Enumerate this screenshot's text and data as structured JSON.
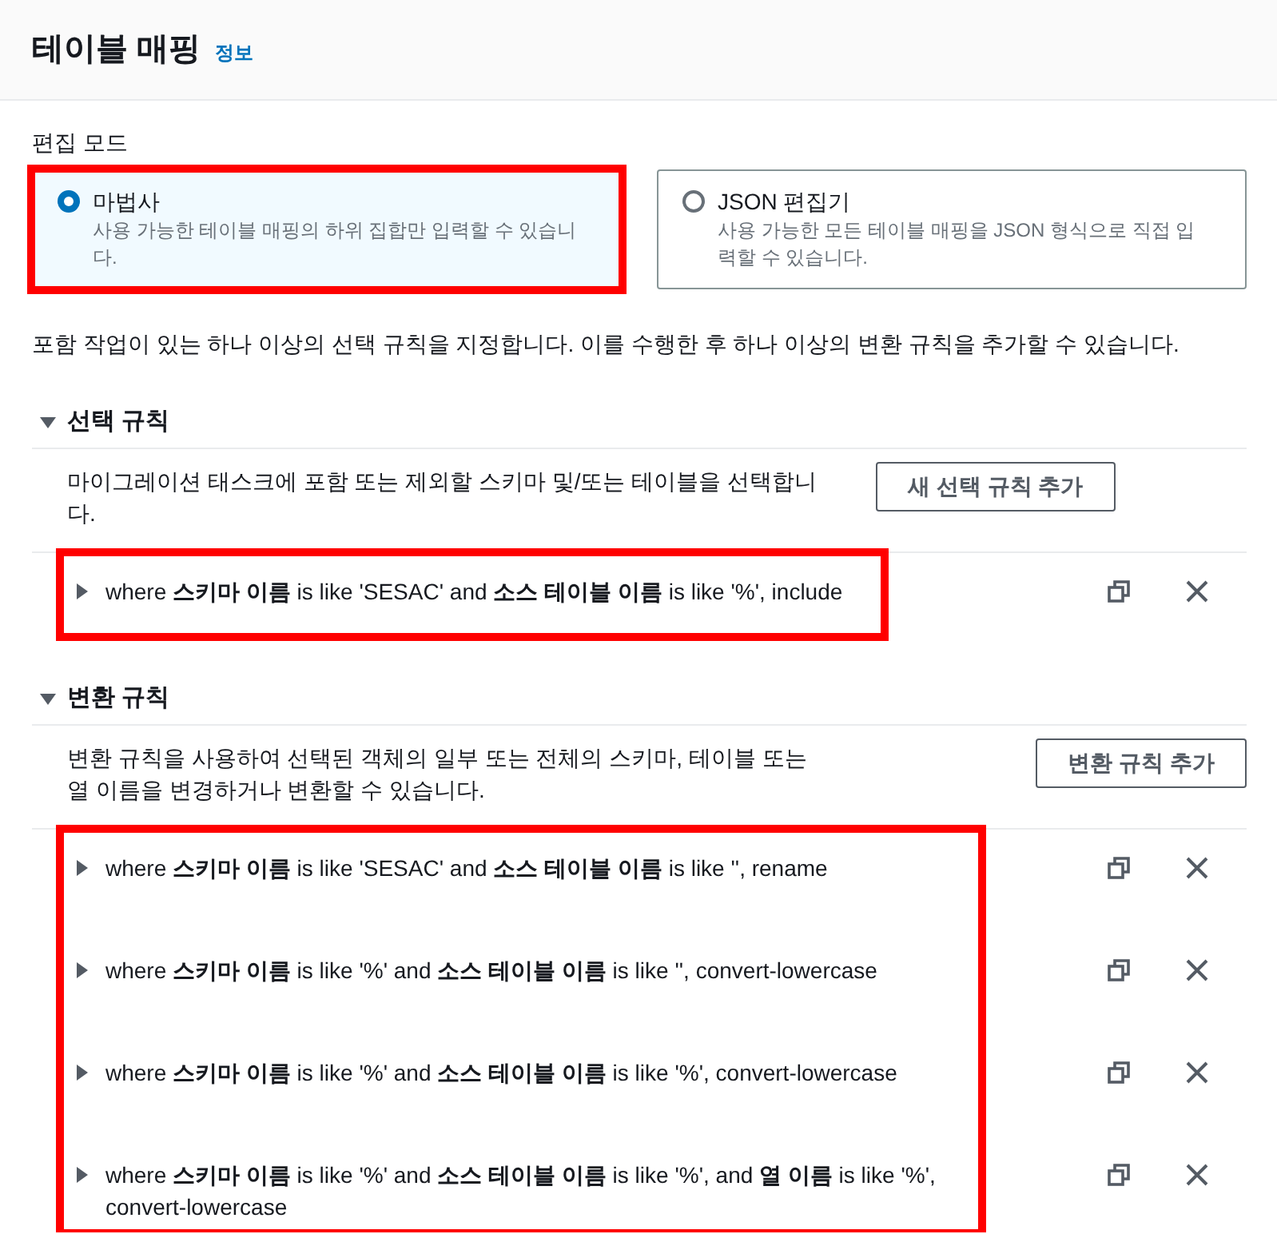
{
  "header": {
    "title": "테이블 매핑",
    "info_link": "정보"
  },
  "edit_mode": {
    "label": "편집 모드",
    "options": [
      {
        "title": "마법사",
        "description": "사용 가능한 테이블 매핑의 하위 집합만 입력할 수 있습니다.",
        "selected": true,
        "highlighted": true
      },
      {
        "title": "JSON 편집기",
        "description": "사용 가능한 모든 테이블 매핑을 JSON 형식으로 직접 입력할 수 있습니다.",
        "selected": false,
        "highlighted": false
      }
    ]
  },
  "intro": "포함 작업이 있는 하나 이상의 선택 규칙을 지정합니다. 이를 수행한 후 하나 이상의 변환 규칙을 추가할 수 있습니다.",
  "sections": [
    {
      "kind": "selection",
      "title": "선택 규칙",
      "expanded": true,
      "description": "마이그레이션 태스크에 포함 또는 제외할 스키마 및/또는 테이블을 선택합니다.",
      "add_button": "새 선택 규칙 추가",
      "rules_highlighted": true,
      "rules": [
        {
          "text": "where **스키마 이름** is like 'SESAC' and **소스 테이블 이름** is like '%', include",
          "expanded": false
        }
      ]
    },
    {
      "kind": "transformation",
      "title": "변환 규칙",
      "expanded": true,
      "description": "변환 규칙을 사용하여 선택된 객체의 일부 또는 전체의 스키마, 테이블 또는 열 이름을 변경하거나 변환할 수 있습니다.",
      "add_button": "변환 규칙 추가",
      "rules_highlighted": true,
      "rules": [
        {
          "text": "where **스키마 이름** is like 'SESAC' and **소스 테이블 이름** is like '', rename",
          "expanded": false
        },
        {
          "text": "where **스키마 이름** is like '%' and **소스 테이블 이름** is like '', convert-lowercase",
          "expanded": false
        },
        {
          "text": "where **스키마 이름** is like '%' and **소스 테이블 이름** is like '%', convert-lowercase",
          "expanded": false
        },
        {
          "text": "where **스키마 이름** is like '%' and **소스 테이블 이름** is like '%', and **열 이름** is like '%', convert-lowercase",
          "expanded": false
        }
      ]
    }
  ]
}
